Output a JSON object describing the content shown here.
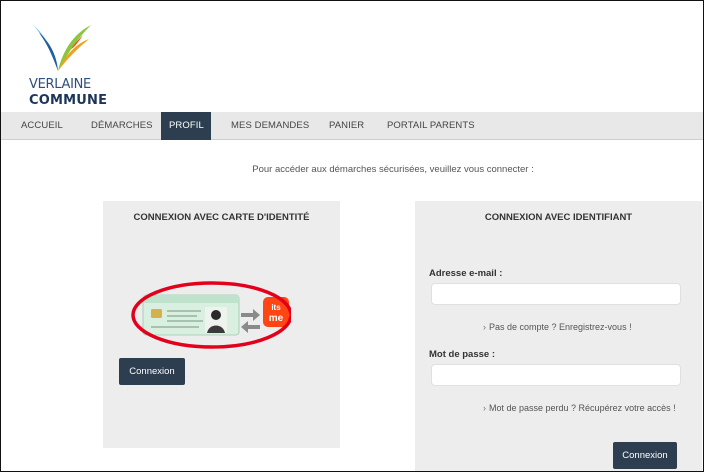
{
  "header": {
    "logo_line1": "VERLAINE",
    "logo_line2": "COMMUNE"
  },
  "nav": {
    "items": [
      {
        "label": "ACCUEIL"
      },
      {
        "label": "DÉMARCHES"
      },
      {
        "label": "PROFIL",
        "active": true
      },
      {
        "label": "MES DEMANDES"
      },
      {
        "label": "PANIER"
      },
      {
        "label": "PORTAIL PARENTS"
      }
    ]
  },
  "intro_text": "Pour accéder aux démarches sécurisées, veuillez vous connecter :",
  "eid_panel": {
    "title": "CONNEXION AVEC CARTE D'IDENTITÉ",
    "itsme_text": "its me",
    "button_label": "Connexion"
  },
  "login_panel": {
    "title": "CONNEXION AVEC IDENTIFIANT",
    "email_label": "Adresse e-mail :",
    "email_value": "",
    "register_link": "Pas de compte ? Enregistrez-vous !",
    "password_label": "Mot de passe :",
    "password_value": "",
    "forgot_link": "Mot de passe perdu ? Récupérez votre accès !",
    "button_label": "Connexion"
  },
  "colors": {
    "nav_active": "#2c3e50",
    "button": "#2c3e50",
    "panel_bg": "#ededed",
    "nav_bg": "#e8e8e8",
    "itsme": "#ff4612",
    "highlight_circle": "#e3001b"
  }
}
